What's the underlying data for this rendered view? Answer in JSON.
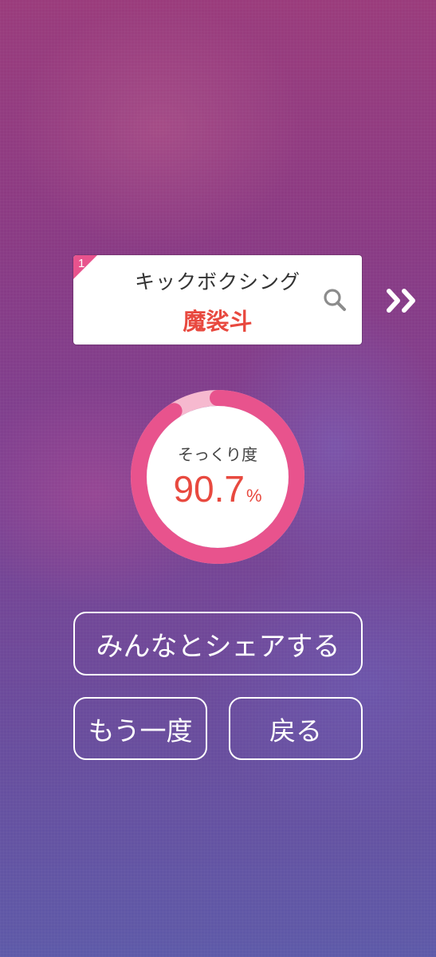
{
  "result": {
    "rank": "1",
    "category": "キックボクシング",
    "name": "魔裟斗",
    "similarity_label": "そっくり度",
    "similarity_value": "90.7",
    "similarity_unit": "%",
    "similarity_fraction": 0.907
  },
  "buttons": {
    "share": "みんなとシェアする",
    "retry": "もう一度",
    "back": "戻る"
  },
  "colors": {
    "accent": "#e8538d",
    "name_text": "#e8493f",
    "gauge_track": "#f6b9cf"
  },
  "icons": {
    "search": "search-icon",
    "next": "double-chevron-right-icon"
  }
}
